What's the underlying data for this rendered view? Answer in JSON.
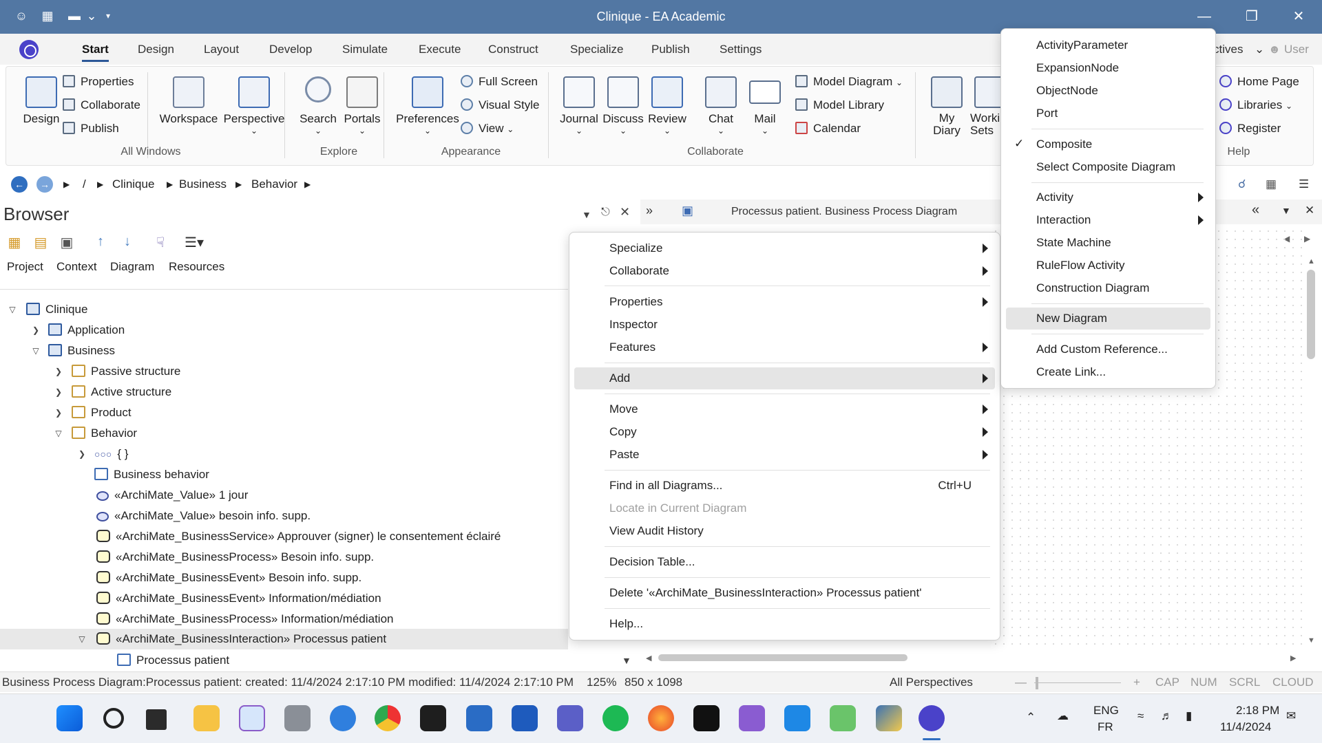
{
  "window": {
    "title": "Clinique - EA Academic"
  },
  "ribbon_tabs": [
    "Start",
    "Design",
    "Layout",
    "Develop",
    "Simulate",
    "Execute",
    "Construct",
    "Specialize",
    "Publish",
    "Settings"
  ],
  "ribbon_right": {
    "perspectives": "ctives",
    "user": "User"
  },
  "ribbon": {
    "windows": {
      "design": "Design",
      "properties": "Properties",
      "collaborate": "Collaborate",
      "publish": "Publish",
      "workspace": "Workspace",
      "perspective": "Perspective",
      "group": "All Windows"
    },
    "explore": {
      "search": "Search",
      "portals": "Portals",
      "group": "Explore"
    },
    "appearance": {
      "preferences": "Preferences",
      "full_screen": "Full Screen",
      "visual_style": "Visual Style",
      "view": "View",
      "group": "Appearance"
    },
    "collaborate": {
      "journal": "Journal",
      "discuss": "Discuss",
      "review": "Review",
      "chat": "Chat",
      "mail": "Mail",
      "model_diagram": "Model Diagram",
      "model_library": "Model Library",
      "calendar": "Calendar",
      "my_diary_1": "My",
      "my_diary_2": "Diary",
      "working_sets_1": "Workin",
      "working_sets_2": "Sets",
      "group": "Collaborate"
    },
    "help": {
      "home_page": "Home Page",
      "libraries": "Libraries",
      "register": "Register",
      "group": "Help"
    }
  },
  "breadcrumb": {
    "root": "/",
    "items": [
      "Clinique",
      "Business",
      "Behavior"
    ]
  },
  "browser": {
    "title": "Browser",
    "tabs": [
      "Project",
      "Context",
      "Diagram",
      "Resources"
    ],
    "tree": [
      {
        "text": "Clinique"
      },
      {
        "text": "Application"
      },
      {
        "text": "Business"
      },
      {
        "text": "Passive structure"
      },
      {
        "text": "Active structure"
      },
      {
        "text": "Product"
      },
      {
        "text": "Behavior"
      },
      {
        "text": "{ }"
      },
      {
        "text": "Business behavior"
      },
      {
        "text": "«ArchiMate_Value» 1 jour"
      },
      {
        "text": "«ArchiMate_Value» besoin info. supp."
      },
      {
        "text": "«ArchiMate_BusinessService» Approuver (signer) le consentement éclairé"
      },
      {
        "text": "«ArchiMate_BusinessProcess» Besoin info. supp."
      },
      {
        "text": "«ArchiMate_BusinessEvent» Besoin info. supp."
      },
      {
        "text": "«ArchiMate_BusinessEvent» Information/médiation"
      },
      {
        "text": "«ArchiMate_BusinessProcess» Information/médiation"
      },
      {
        "text": "«ArchiMate_BusinessInteraction» Processus patient"
      },
      {
        "text": "Processus patient"
      }
    ]
  },
  "diagram_tab": {
    "label": "Processus patient.  Business Process Diagram"
  },
  "context_menu": {
    "items": [
      {
        "label": "Specialize"
      },
      {
        "label": "Collaborate"
      },
      {
        "label": "Properties"
      },
      {
        "label": "Inspector"
      },
      {
        "label": "Features"
      },
      {
        "label": "Add"
      },
      {
        "label": "Move"
      },
      {
        "label": "Copy"
      },
      {
        "label": "Paste"
      },
      {
        "label": "Find in all Diagrams...",
        "shortcut": "Ctrl+U"
      },
      {
        "label": "Locate in Current Diagram"
      },
      {
        "label": "View Audit History"
      },
      {
        "label": "Decision Table..."
      },
      {
        "label": "Delete '«ArchiMate_BusinessInteraction» Processus patient'"
      },
      {
        "label": "Help..."
      }
    ]
  },
  "add_submenu": {
    "items": [
      {
        "label": "ActivityParameter"
      },
      {
        "label": "ExpansionNode"
      },
      {
        "label": "ObjectNode"
      },
      {
        "label": "Port"
      },
      {
        "label": "Composite",
        "checked": "✓"
      },
      {
        "label": "Select Composite Diagram"
      },
      {
        "label": "Activity"
      },
      {
        "label": "Interaction"
      },
      {
        "label": "State Machine"
      },
      {
        "label": "RuleFlow Activity"
      },
      {
        "label": "Construction Diagram"
      },
      {
        "label": "New Diagram"
      },
      {
        "label": "Add Custom Reference..."
      },
      {
        "label": "Create Link..."
      }
    ]
  },
  "status_bar": {
    "info": "Business Process Diagram:Processus patient:   created: 11/4/2024 2:17:10 PM  modified: 11/4/2024 2:17:10 PM",
    "zoom": "125%",
    "size": "850 x 1098",
    "perspectives": "All Perspectives",
    "cap": "CAP",
    "num": "NUM",
    "scrl": "SCRL",
    "cloud": "CLOUD"
  },
  "taskbar": {
    "lang": "ENG",
    "region": "FR",
    "time": "2:18 PM",
    "date": "11/4/2024"
  },
  "colors": {
    "titlebar": "#5277a3",
    "accent": "#2b5797",
    "selection": "#e5e5e5"
  }
}
